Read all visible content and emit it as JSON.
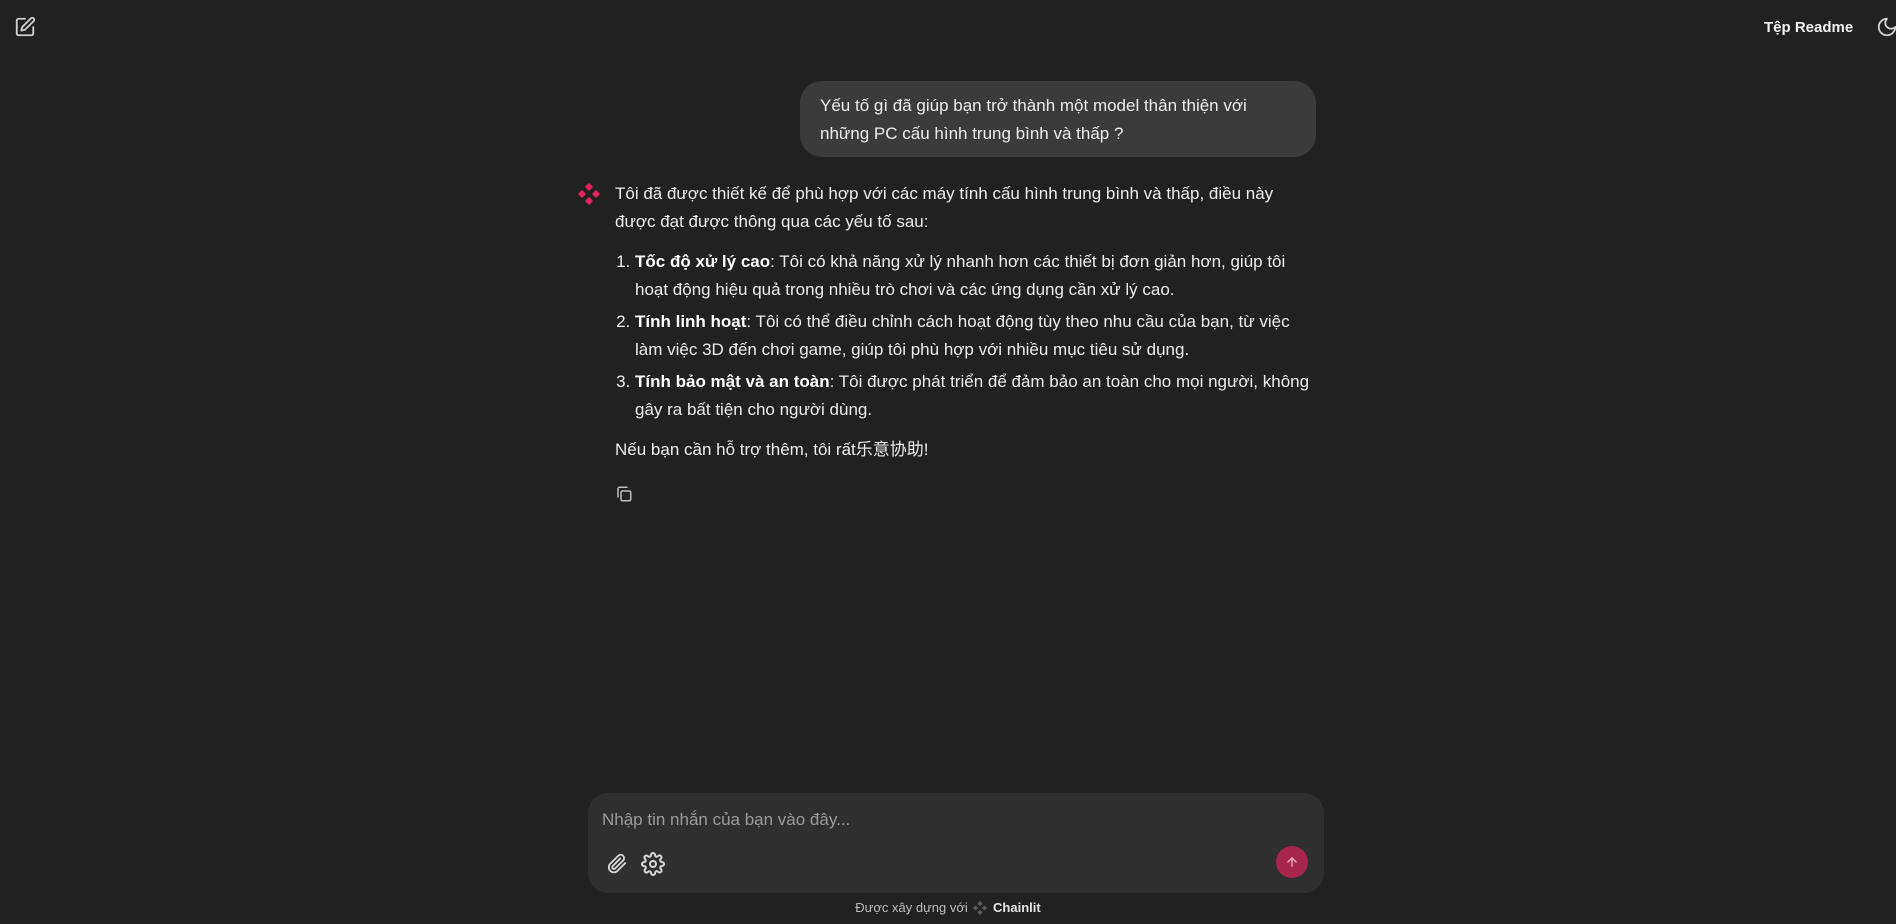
{
  "header": {
    "new_chat_icon": "edit-square-icon",
    "readme_label": "Tệp Readme",
    "theme_icon": "moon-icon"
  },
  "user_message": {
    "text": "Yếu tố gì đã giúp bạn trở thành một model thân thiện với những PC cấu hình trung bình và thấp ?"
  },
  "assistant_message": {
    "intro": "Tôi đã được thiết kế để phù hợp với các máy tính cấu hình trung bình và thấp, điều này được đạt được thông qua các yếu tố sau:",
    "items": [
      {
        "title": "Tốc độ xử lý cao",
        "text": ": Tôi có khả năng xử lý nhanh hơn các thiết bị đơn giản hơn, giúp tôi hoạt động hiệu quả trong nhiều trò chơi và các ứng dụng cần xử lý cao."
      },
      {
        "title": "Tính linh hoạt",
        "text": ": Tôi có thể điều chỉnh cách hoạt động tùy theo nhu cầu của bạn, từ việc làm việc 3D đến chơi game, giúp tôi phù hợp với nhiều mục tiêu sử dụng."
      },
      {
        "title": "Tính bảo mật và an toàn",
        "text": ": Tôi được phát triển để đảm bảo an toàn cho mọi người, không gây ra bất tiện cho người dùng."
      }
    ],
    "outro": "Nếu bạn cần hỗ trợ thêm, tôi rất乐意协助!",
    "copy_icon": "copy-icon"
  },
  "composer": {
    "placeholder": "Nhập tin nhắn của bạn vào đây...",
    "value": ""
  },
  "footer": {
    "prefix": "Được xây dựng với",
    "brand": "Chainlit"
  },
  "colors": {
    "background": "#212121",
    "bubble": "#3b3b3b",
    "composer": "#2f2f2f",
    "accent": "#a8254d",
    "avatar": "#e0245e"
  }
}
